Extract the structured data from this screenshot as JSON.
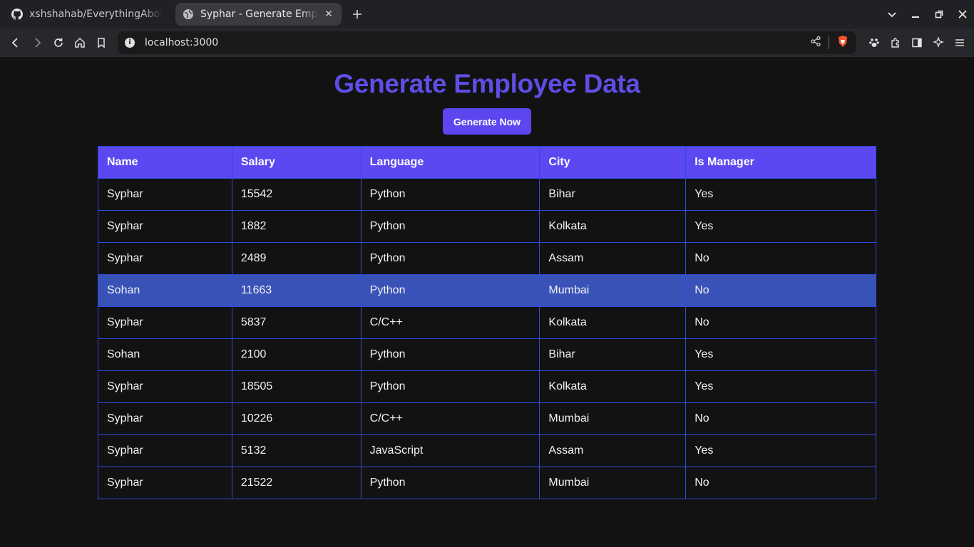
{
  "browser": {
    "tabs": [
      {
        "title": "xshshahab/EverythingAbout",
        "favicon": "github-icon",
        "active": false
      },
      {
        "title": "Syphar - Generate Emplo",
        "favicon": "globe-icon",
        "active": true
      }
    ],
    "address": "localhost:3000"
  },
  "page": {
    "title": "Generate Employee Data",
    "button_label": "Generate Now",
    "accent_color": "#5c46ef",
    "highlight_row_color": "#3952b8"
  },
  "table": {
    "headers": [
      "Name",
      "Salary",
      "Language",
      "City",
      "Is Manager"
    ],
    "highlighted_row": 3,
    "rows": [
      [
        "Syphar",
        "15542",
        "Python",
        "Bihar",
        "Yes"
      ],
      [
        "Syphar",
        "1882",
        "Python",
        "Kolkata",
        "Yes"
      ],
      [
        "Syphar",
        "2489",
        "Python",
        "Assam",
        "No"
      ],
      [
        "Sohan",
        "11663",
        "Python",
        "Mumbai",
        "No"
      ],
      [
        "Syphar",
        "5837",
        "C/C++",
        "Kolkata",
        "No"
      ],
      [
        "Sohan",
        "2100",
        "Python",
        "Bihar",
        "Yes"
      ],
      [
        "Syphar",
        "18505",
        "Python",
        "Kolkata",
        "Yes"
      ],
      [
        "Syphar",
        "10226",
        "C/C++",
        "Mumbai",
        "No"
      ],
      [
        "Syphar",
        "5132",
        "JavaScript",
        "Assam",
        "Yes"
      ],
      [
        "Syphar",
        "21522",
        "Python",
        "Mumbai",
        "No"
      ]
    ]
  }
}
